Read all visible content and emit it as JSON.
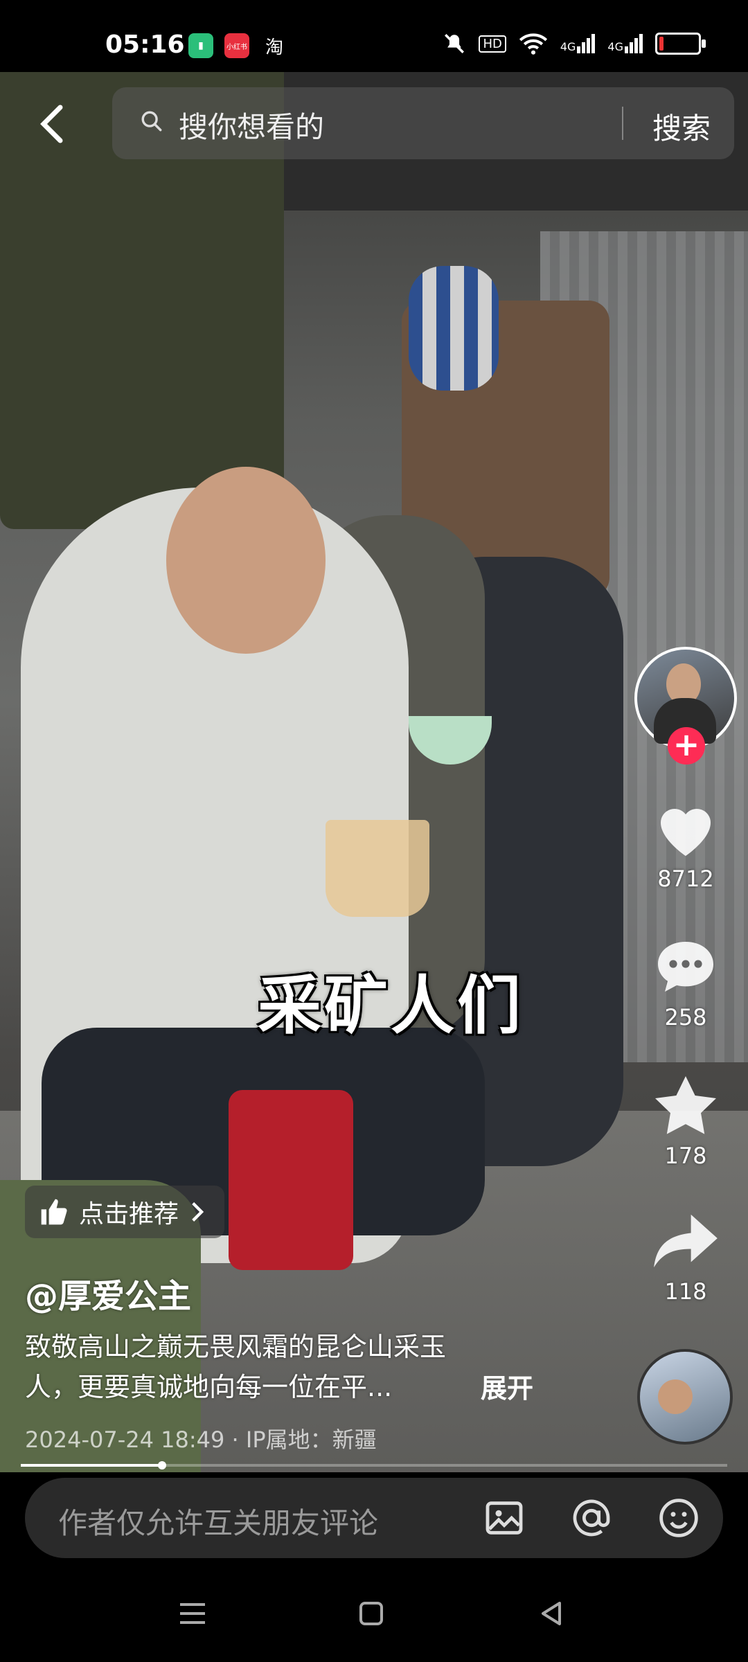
{
  "status_bar": {
    "time": "05:16",
    "app1": "▮",
    "app2": "小红书",
    "app3": "淘",
    "network": "4G",
    "network2": "4G",
    "hd": "HD"
  },
  "search": {
    "placeholder": "搜你想看的",
    "button": "搜索"
  },
  "video": {
    "caption": "采矿人们"
  },
  "actions": {
    "likes": "8712",
    "comments": "258",
    "favorites": "178",
    "shares": "118"
  },
  "info": {
    "recommend": "点击推荐",
    "author": "@厚爱公主",
    "description_line1": "致敬高山之巅无畏风霜的昆仑山采玉",
    "description_line2": "人，更要真诚地向每一位在平...",
    "expand": "展开",
    "meta": "2024-07-24 18:49 · IP属地：新疆",
    "progress": 0.2
  },
  "comment": {
    "placeholder": "作者仅允许互关朋友评论"
  },
  "colors": {
    "accent": "#fe2c55",
    "like": "#ffffff"
  },
  "icons": [
    "back-icon",
    "search-icon",
    "heart-icon",
    "comment-icon",
    "star-icon",
    "share-icon",
    "thumbs-up-icon",
    "image-icon",
    "at-icon",
    "emoji-icon"
  ]
}
